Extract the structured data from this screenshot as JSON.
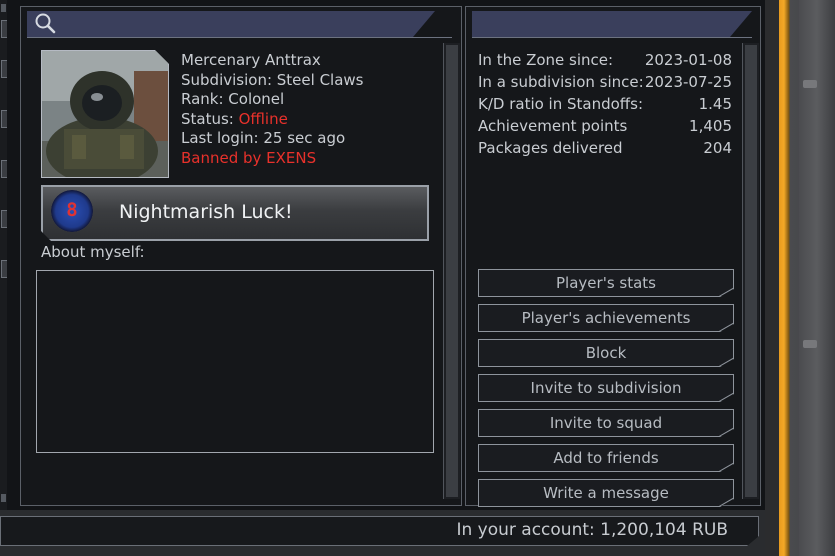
{
  "profile": {
    "name": "Mercenary Anttrax",
    "subdivision": "Subdivision: Steel Claws",
    "rank": "Rank: Colonel",
    "status_label": "Status: ",
    "status_value": "Offline",
    "last_login": "Last login: 25 sec ago",
    "ban_notice": "Banned by EXENS"
  },
  "achievement": {
    "icon_digit": "8",
    "label": "Nightmarish Luck!"
  },
  "about": {
    "label": "About myself:",
    "text": ""
  },
  "stats": [
    {
      "label": "In the Zone since:",
      "value": "2023-01-08"
    },
    {
      "label": "In a subdivision since:",
      "value": "2023-07-25"
    },
    {
      "label": "K/D ratio in Standoffs:",
      "value": "1.45"
    },
    {
      "label": "Achievement points",
      "value": "1,405"
    },
    {
      "label": "Packages delivered",
      "value": "204"
    }
  ],
  "actions": [
    {
      "label": "Player's stats"
    },
    {
      "label": "Player's achievements"
    },
    {
      "label": "Block"
    },
    {
      "label": "Invite to subdivision"
    },
    {
      "label": "Invite to squad"
    },
    {
      "label": "Add to friends"
    },
    {
      "label": "Write a message"
    }
  ],
  "account": {
    "text": "In your account: 1,200,104 RUB"
  },
  "colors": {
    "accent_orange": "#f3a826",
    "status_red": "#e8312b",
    "header_blue": "#3a3f5c"
  },
  "icons": {
    "search": "search-icon",
    "achievement": "achievement-badge-icon"
  }
}
